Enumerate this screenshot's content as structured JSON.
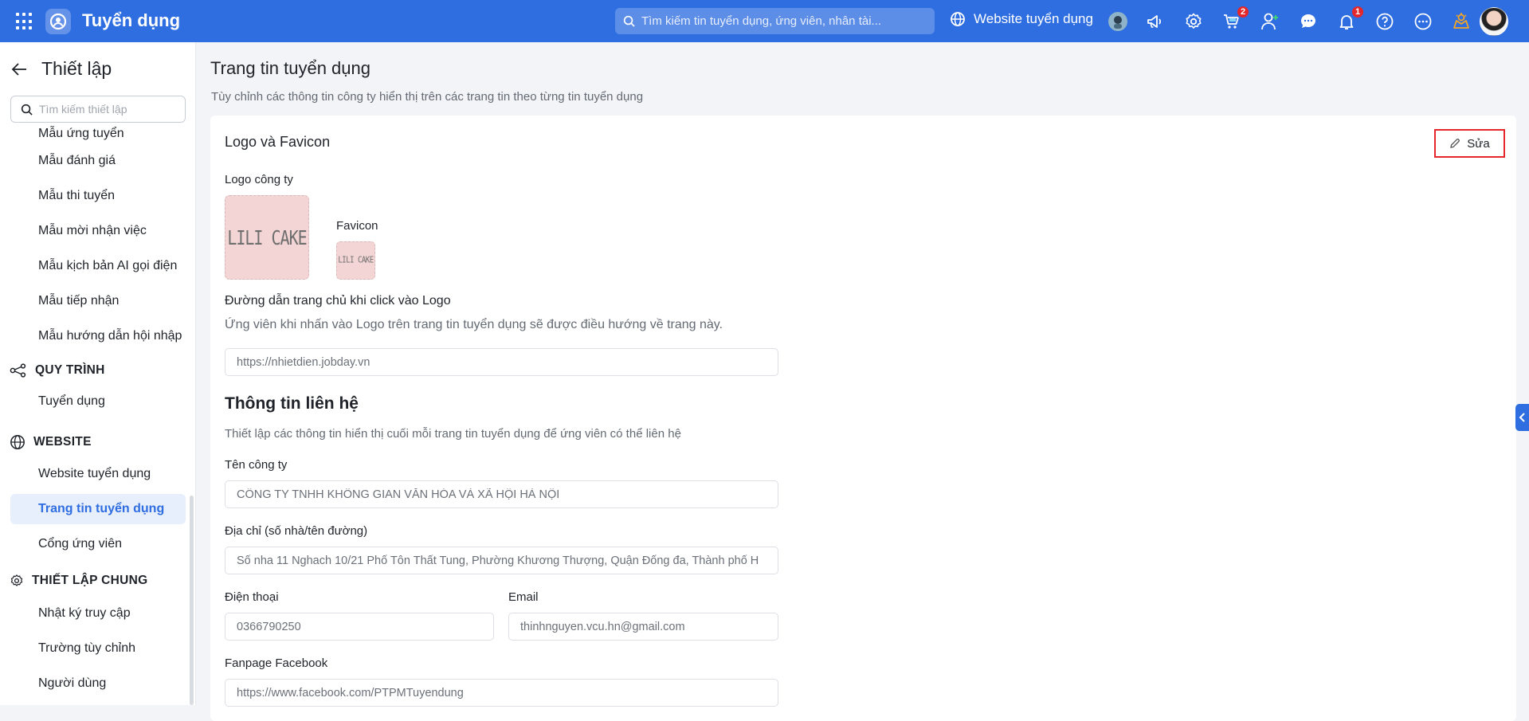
{
  "header": {
    "brand": "Tuyển dụng",
    "search_placeholder": "Tìm kiếm tin tuyển dụng, ứng viên, nhân tài...",
    "website_link": "Website tuyển dụng",
    "badges": {
      "cart": "2",
      "notifications": "1"
    },
    "icons": [
      "apps-grid-icon",
      "bot-avatar-icon",
      "megaphone-icon",
      "gear-icon",
      "cart-icon",
      "add-user-icon",
      "chat-icon",
      "bell-icon",
      "help-icon",
      "more-icon",
      "reward-icon"
    ]
  },
  "sidebar": {
    "title": "Thiết lập",
    "search_placeholder": "Tìm kiếm thiết lập",
    "items_top": [
      "Mẫu ứng tuyển",
      "Mẫu đánh giá",
      "Mẫu thi tuyển",
      "Mẫu mời nhận việc",
      "Mẫu kịch bản AI gọi điện",
      "Mẫu tiếp nhận",
      "Mẫu hướng dẫn hội nhập"
    ],
    "section_process": "QUY TRÌNH",
    "process_items": [
      "Tuyển dụng"
    ],
    "section_website": "WEBSITE",
    "website_items": [
      "Website tuyển dụng",
      "Trang tin tuyển dụng",
      "Cổng ứng viên"
    ],
    "section_general": "THIẾT LẬP CHUNG",
    "general_items": [
      "Nhật ký truy cập",
      "Trường tùy chỉnh",
      "Người dùng"
    ]
  },
  "main": {
    "title": "Trang tin tuyển dụng",
    "subtitle": "Tùy chỉnh các thông tin công ty hiển thị trên các trang tin theo từng tin tuyển dụng",
    "edit_label": "Sửa",
    "logo_section": {
      "title": "Logo và Favicon",
      "logo_label": "Logo công ty",
      "logo_text": "LILI CAKE",
      "favicon_label": "Favicon",
      "favicon_text": "LILI CAKE"
    },
    "homepage_link": {
      "label": "Đường dẫn trang chủ khi click vào Logo",
      "description": "Ứng viên khi nhấn vào Logo trên trang tin tuyển dụng sẽ được điều hướng về trang này.",
      "value": "https://nhietdien.jobday.vn"
    },
    "contact": {
      "title": "Thông tin liên hệ",
      "description": "Thiết lập các thông tin hiển thị cuối mỗi trang tin tuyển dụng để ứng viên có thể liên hệ",
      "company_label": "Tên công ty",
      "company_value": "CÔNG TY TNHH KHÔNG GIAN VĂN HÓA VÀ XÃ HỘI HÀ NỘI",
      "address_label": "Địa chỉ (số nhà/tên đường)",
      "address_value": "Số nha 11 Nghach 10/21 Phố Tôn Thất Tung, Phường Khương Thượng, Quận Đống đa, Thành phố H",
      "phone_label": "Điện thoại",
      "phone_value": "0366790250",
      "email_label": "Email",
      "email_value": "thinhnguyen.vcu.hn@gmail.com",
      "fanpage_label": "Fanpage Facebook",
      "fanpage_value": "https://www.facebook.com/PTPMTuyendung"
    }
  },
  "colors": {
    "primary": "#2f6ee0",
    "highlight": "#e5262b",
    "badge": "#e5262b",
    "active_bg": "#e7eefc"
  }
}
